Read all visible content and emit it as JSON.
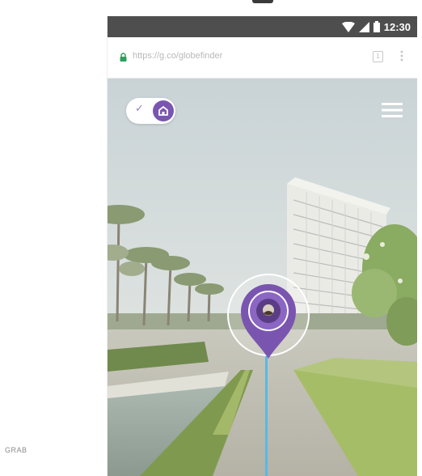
{
  "caption": "GRAB",
  "status_bar": {
    "time": "12:30",
    "icons": [
      "wifi-icon",
      "cell-signal-icon",
      "battery-icon"
    ]
  },
  "browser": {
    "url": "https://g.co/globefinder",
    "tab_count": "1",
    "icons": [
      "lock-icon",
      "tab-switcher-icon",
      "more-vert-icon"
    ]
  },
  "map_view": {
    "toggle_state": "on",
    "toggle_icons": [
      "check-icon",
      "home-icon"
    ],
    "menu_icon": "hamburger-menu-icon",
    "pin_icon": "location-pin-icon"
  },
  "colors": {
    "accent_purple": "#7a55b0",
    "path_blue": "#5ab8e6",
    "status_bar": "#4e4e4e"
  }
}
